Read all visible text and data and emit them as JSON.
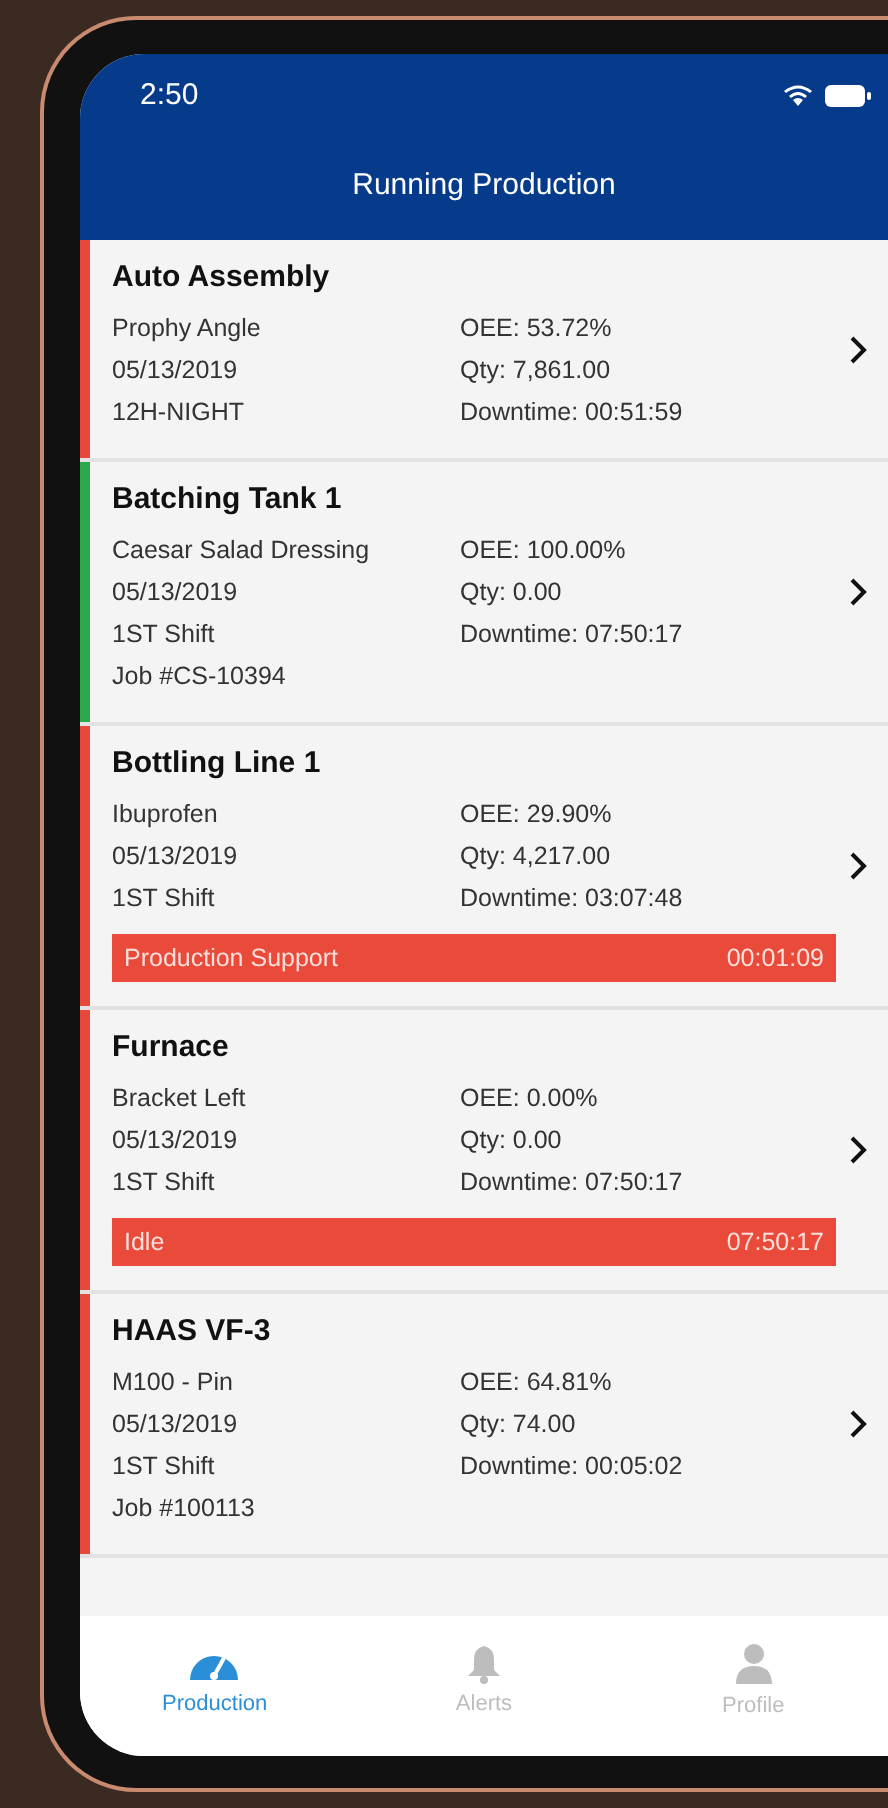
{
  "status_bar": {
    "time": "2:50"
  },
  "header": {
    "title": "Running Production"
  },
  "machines": [
    {
      "name": "Auto Assembly",
      "color": "#e8483a",
      "left": [
        "Prophy Angle",
        "05/13/2019",
        "12H-NIGHT"
      ],
      "right": [
        "OEE: 53.72%",
        "Qty: 7,861.00",
        "Downtime: 00:51:59"
      ]
    },
    {
      "name": "Batching Tank 1",
      "color": "#2aa84a",
      "left": [
        "Caesar Salad Dressing",
        "05/13/2019",
        "1ST Shift",
        "Job #CS-10394"
      ],
      "right": [
        "OEE: 100.00%",
        "Qty: 0.00",
        "Downtime: 07:50:17"
      ]
    },
    {
      "name": "Bottling Line 1",
      "color": "#e8483a",
      "left": [
        "Ibuprofen",
        "05/13/2019",
        "1ST Shift"
      ],
      "right": [
        "OEE: 29.90%",
        "Qty: 4,217.00",
        "Downtime: 03:07:48"
      ],
      "alert": {
        "label": "Production Support",
        "time": "00:01:09"
      }
    },
    {
      "name": "Furnace",
      "color": "#e8483a",
      "left": [
        "Bracket Left",
        "05/13/2019",
        "1ST Shift"
      ],
      "right": [
        "OEE: 0.00%",
        "Qty: 0.00",
        "Downtime: 07:50:17"
      ],
      "alert": {
        "label": "Idle",
        "time": "07:50:17"
      }
    },
    {
      "name": "HAAS VF-3",
      "color": "#e8483a",
      "left": [
        "M100 - Pin",
        "05/13/2019",
        "1ST Shift",
        "Job #100113"
      ],
      "right": [
        "OEE: 64.81%",
        "Qty: 74.00",
        "Downtime: 00:05:02"
      ]
    }
  ],
  "tabs": [
    {
      "label": "Production",
      "kind": "gauge",
      "selected": true
    },
    {
      "label": "Alerts",
      "kind": "bell",
      "selected": false
    },
    {
      "label": "Profile",
      "kind": "person",
      "selected": false
    }
  ]
}
